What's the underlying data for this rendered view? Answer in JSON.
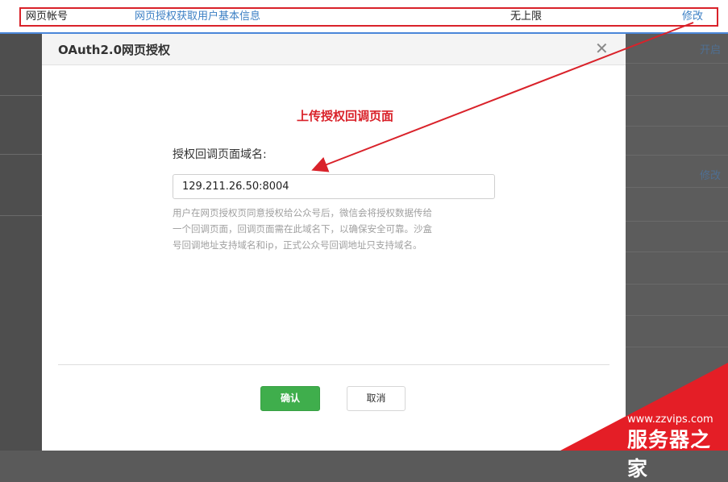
{
  "top_row": {
    "name": "网页帐号",
    "description": "网页授权获取用户基本信息",
    "limit": "无上限",
    "edit": "修改"
  },
  "background": {
    "link_open": "开启",
    "link_edit": "修改"
  },
  "modal": {
    "title": "OAuth2.0网页授权",
    "close_icon": "close-icon",
    "section_title": "上传授权回调页面",
    "field_label": "授权回调页面域名:",
    "field_value": "129.211.26.50:8004",
    "help_line1": "用户在网页授权页同意授权给公众号后，微信会将授权数据传给",
    "help_line2": "一个回调页面，回调页面需在此域名下，以确保安全可靠。沙盒",
    "help_line3": "号回调地址支持域名和ip，正式公众号回调地址只支持域名。",
    "confirm_label": "确认",
    "cancel_label": "取消"
  },
  "watermark": {
    "url": "www.zzvips.com",
    "name": "服务器之家"
  },
  "colors": {
    "annotation_red": "#d9222a",
    "link_blue": "#3b7fc4",
    "confirm_green": "#3fae4c"
  }
}
